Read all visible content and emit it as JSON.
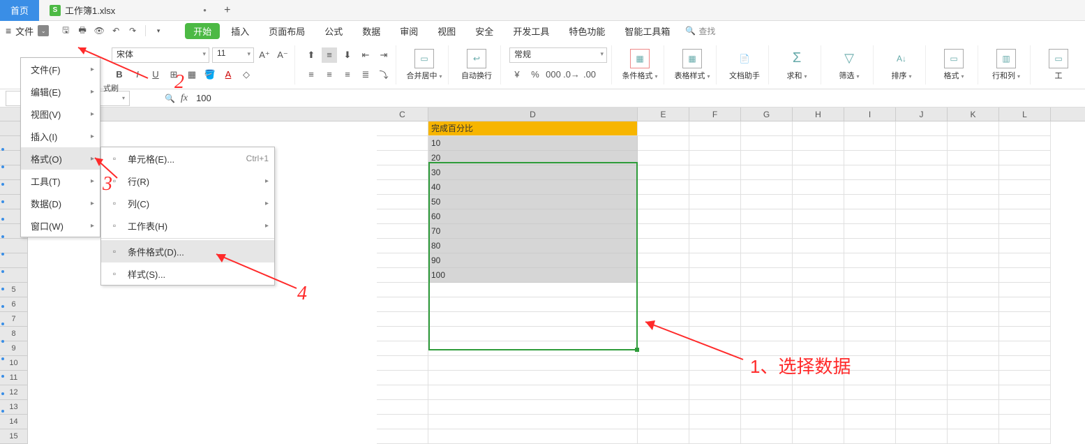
{
  "tabs": {
    "home": "首页",
    "file": "工作簿1.xlsx"
  },
  "menubar": {
    "file": "文件",
    "ribbon": [
      "开始",
      "插入",
      "页面布局",
      "公式",
      "数据",
      "审阅",
      "视图",
      "安全",
      "开发工具",
      "特色功能",
      "智能工具箱"
    ],
    "search": "查找"
  },
  "ribbon": {
    "format_painter": "式刷",
    "font": "宋体",
    "size": "11",
    "numfmt": "常规",
    "merge": "合并居中",
    "wrap": "自动换行",
    "condfmt": "条件格式",
    "tablestyle": "表格样式",
    "dochelper": "文档助手",
    "sum": "求和",
    "filter": "筛选",
    "sort": "排序",
    "format": "格式",
    "rowcol": "行和列",
    "worksheet": "工"
  },
  "fxbar": {
    "namebox": "",
    "value": "100"
  },
  "columns": [
    "C",
    "D",
    "E",
    "F",
    "G",
    "H",
    "I",
    "J",
    "K",
    "L"
  ],
  "row_numbers": [
    5,
    6,
    7,
    8,
    9,
    10,
    11,
    12,
    13,
    14,
    15
  ],
  "d_header": "完成百分比",
  "d_values": [
    "10",
    "20",
    "30",
    "40",
    "50",
    "60",
    "70",
    "80",
    "90",
    "100"
  ],
  "menu1": [
    {
      "label": "文件(F)",
      "arr": true
    },
    {
      "label": "编辑(E)",
      "arr": true
    },
    {
      "label": "视图(V)",
      "arr": true
    },
    {
      "label": "插入(I)",
      "arr": true
    },
    {
      "label": "格式(O)",
      "arr": true,
      "hover": true
    },
    {
      "label": "工具(T)",
      "arr": true
    },
    {
      "label": "数据(D)",
      "arr": true
    },
    {
      "label": "窗口(W)",
      "arr": true
    }
  ],
  "menu2": [
    {
      "label": "单元格(E)...",
      "shortcut": "Ctrl+1"
    },
    {
      "label": "行(R)",
      "arr": true
    },
    {
      "label": "列(C)",
      "arr": true
    },
    {
      "label": "工作表(H)",
      "arr": true
    },
    {
      "sep": true
    },
    {
      "label": "条件格式(D)...",
      "hover": true
    },
    {
      "label": "样式(S)..."
    }
  ],
  "annotations": {
    "n2": "2",
    "n3": "3",
    "n4": "4",
    "label1": "1、选择数据"
  }
}
